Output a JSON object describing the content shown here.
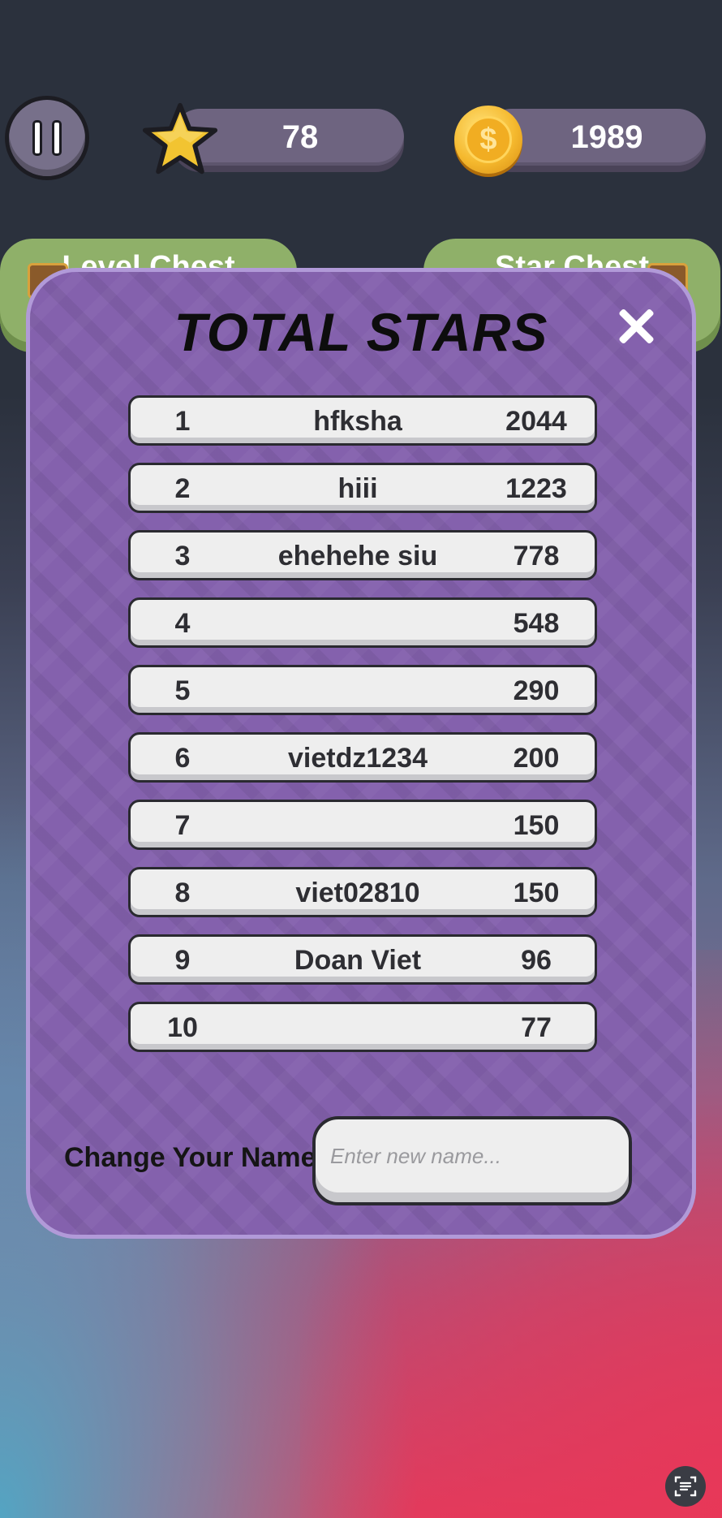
{
  "hud": {
    "stars": "78",
    "coins": "1989",
    "coin_symbol": "$"
  },
  "chests": {
    "left_label": "Level Chest",
    "right_label": "Star Chest"
  },
  "modal": {
    "title": "TOTAL STARS",
    "leaderboard": [
      {
        "rank": "1",
        "name": "hfksha",
        "score": "2044"
      },
      {
        "rank": "2",
        "name": "hiii",
        "score": "1223"
      },
      {
        "rank": "3",
        "name": "ehehehe siu",
        "score": "778"
      },
      {
        "rank": "4",
        "name": "",
        "score": "548"
      },
      {
        "rank": "5",
        "name": "",
        "score": "290"
      },
      {
        "rank": "6",
        "name": "vietdz1234",
        "score": "200"
      },
      {
        "rank": "7",
        "name": "",
        "score": "150"
      },
      {
        "rank": "8",
        "name": "viet02810",
        "score": "150"
      },
      {
        "rank": "9",
        "name": "Doan Viet",
        "score": "96"
      },
      {
        "rank": "10",
        "name": "",
        "score": "77"
      }
    ],
    "change_name_label": "Change Your Name :",
    "name_placeholder": "Enter new name..."
  },
  "icons": {
    "pause": "pause-icon",
    "star": "star-icon",
    "coin": "coin-icon",
    "close": "close-icon",
    "chest": "chest-icon",
    "scan": "scan-text-icon"
  },
  "colors": {
    "modal_bg": "#8461ad",
    "modal_border": "#b19ad8",
    "hud_pill": "#6e6480",
    "chest_green": "#8fb069",
    "row_bg": "#eeeeee"
  }
}
